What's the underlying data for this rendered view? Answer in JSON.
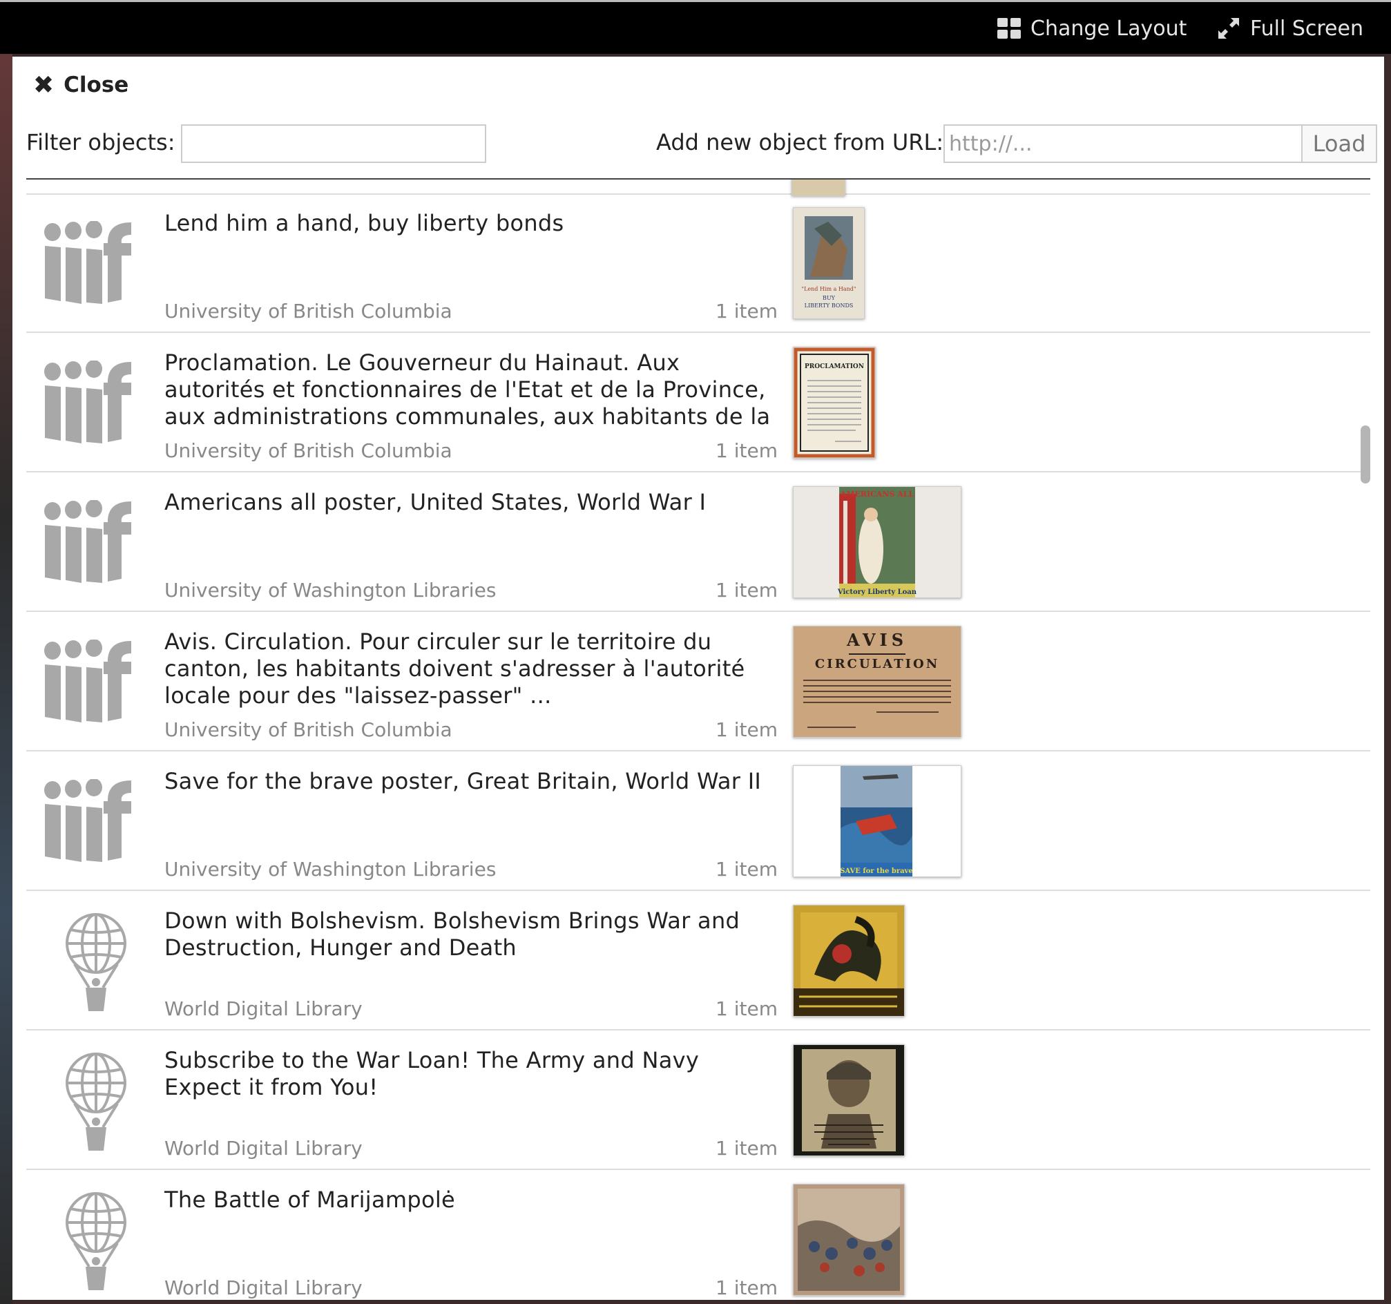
{
  "topbar": {
    "change_layout": "Change Layout",
    "full_screen": "Full Screen"
  },
  "panel": {
    "close_label": "Close",
    "filter_label": "Filter objects:",
    "filter_value": "",
    "url_label": "Add new object from URL:",
    "url_placeholder": "http://...",
    "load_label": "Load"
  },
  "items": [
    {
      "title": "Lend him a hand, buy liberty bonds",
      "institution": "University of British Columbia",
      "count": "1 item",
      "logo": "iiif-logo"
    },
    {
      "title": "Proclamation. Le Gouverneur du Hainaut. Aux autorités et fonctionnaires de l'Etat et de la Province, aux administrations communales, aux habitants de la",
      "institution": "University of British Columbia",
      "count": "1 item",
      "logo": "iiif-logo"
    },
    {
      "title": "Americans all poster, United States, World War I",
      "institution": "University of Washington Libraries",
      "count": "1 item",
      "logo": "iiif-logo"
    },
    {
      "title": "Avis. Circulation. Pour circuler sur le territoire du canton, les habitants doivent s'adresser à l'autorité locale pour des \"laissez-passer\" ...",
      "institution": "University of British Columbia",
      "count": "1 item",
      "logo": "iiif-logo"
    },
    {
      "title": "Save for the brave poster, Great Britain, World War II",
      "institution": "University of Washington Libraries",
      "count": "1 item",
      "logo": "iiif-logo"
    },
    {
      "title": "Down with Bolshevism. Bolshevism Brings War and Destruction, Hunger and Death",
      "institution": "World Digital Library",
      "count": "1 item",
      "logo": "wdl-balloon-logo"
    },
    {
      "title": "Subscribe to the War Loan! The Army and Navy Expect it from You!",
      "institution": "World Digital Library",
      "count": "1 item",
      "logo": "wdl-balloon-logo"
    },
    {
      "title": "The Battle of Marijampolė",
      "institution": "World Digital Library",
      "count": "1 item",
      "logo": "wdl-balloon-logo"
    }
  ],
  "thumb_text": {
    "t0": [
      "\"Lend Him a Hand\"",
      "BUY",
      "LIBERTY BONDS"
    ],
    "t1": "PROCLAMATION",
    "t2": [
      "AMERICANS ALL",
      "Victory Liberty Loan"
    ],
    "t3": [
      "AVIS",
      "CIRCULATION"
    ],
    "t4": "SAVE for the brave"
  },
  "colors": {
    "topbar_bg": "#000000",
    "panel_bg": "#ffffff",
    "title_text": "#222222",
    "meta_text": "#888888",
    "logo_gray": "#a8a8a8"
  }
}
